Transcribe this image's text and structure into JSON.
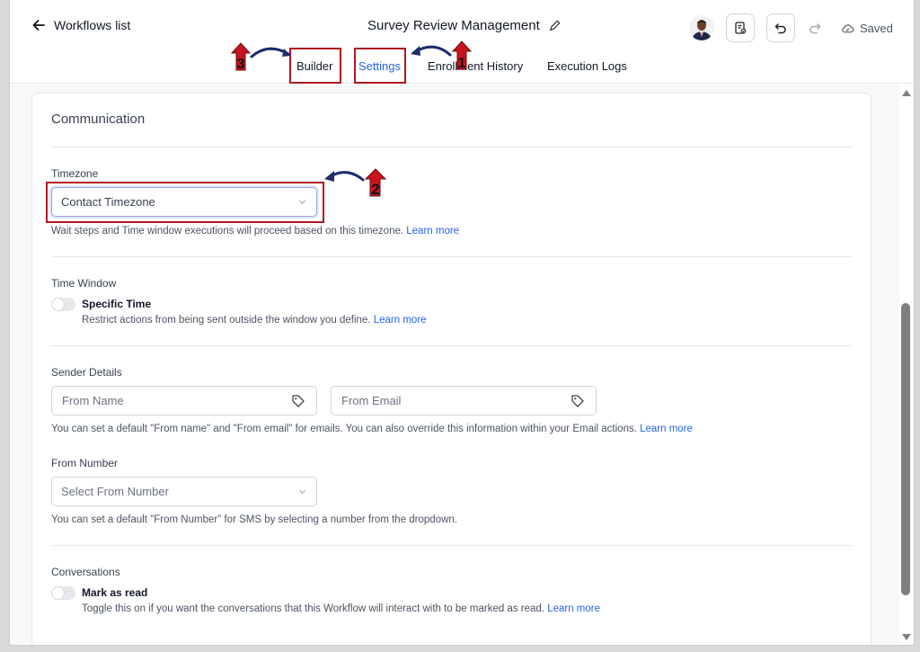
{
  "header": {
    "back_label": "Workflows list",
    "title": "Survey Review Management",
    "saved_label": "Saved"
  },
  "tabs": [
    {
      "label": "Builder",
      "active": false
    },
    {
      "label": "Settings",
      "active": true
    },
    {
      "label": "Enrollment History",
      "active": false
    },
    {
      "label": "Execution Logs",
      "active": false
    }
  ],
  "callouts": [
    "1",
    "2",
    "3"
  ],
  "communication": {
    "title": "Communication",
    "timezone": {
      "label": "Timezone",
      "value": "Contact Timezone",
      "help": "Wait steps and Time window executions will proceed based on this timezone.",
      "link": "Learn more"
    },
    "time_window": {
      "label": "Time Window",
      "toggle_label": "Specific Time",
      "help": "Restrict actions from being sent outside the window you define.",
      "link": "Learn more",
      "enabled": false
    },
    "sender_details": {
      "label": "Sender Details",
      "from_name_placeholder": "From Name",
      "from_email_placeholder": "From Email",
      "help": "You can set a default \"From name\" and \"From email\" for emails. You can also override this information within your Email actions.",
      "link": "Learn more"
    },
    "from_number": {
      "label": "From Number",
      "placeholder": "Select From Number",
      "help": "You can set a default \"From Number\" for SMS by selecting a number from the dropdown."
    },
    "conversations": {
      "label": "Conversations",
      "toggle_label": "Mark as read",
      "help": "Toggle this on if you want the conversations that this Workflow will interact with to be marked as read.",
      "link": "Learn more",
      "enabled": false
    }
  },
  "colors": {
    "accent": "#2563eb",
    "callout_red": "#c8141e",
    "arrow_navy": "#1e2d6b"
  }
}
